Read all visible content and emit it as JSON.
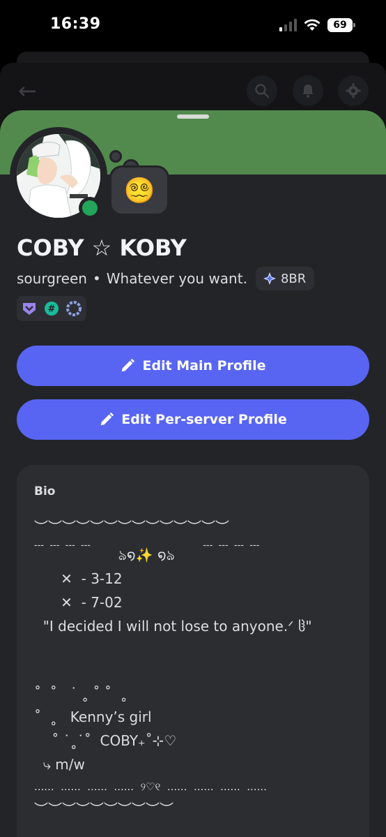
{
  "status_bar": {
    "time": "16:39",
    "battery": "69",
    "icons": [
      "signal-icon",
      "wifi-icon",
      "battery-icon"
    ]
  },
  "background_page": {
    "icons": [
      "back-arrow-icon",
      "search-icon",
      "bell-icon",
      "gear-icon"
    ]
  },
  "profile": {
    "banner_color": "#528a4d",
    "display_name": "COBY ☆ KOBY",
    "username": "sourgreen",
    "separator": "•",
    "pronouns": "Whatever you want.",
    "clan_tag": "8BR",
    "status_emoji": "😵‍💫",
    "status": "online",
    "badges": [
      "hypesquad-balance-icon",
      "hashtag-icon",
      "quest-badge-icon"
    ]
  },
  "buttons": {
    "edit_main": "Edit Main Profile",
    "edit_server": "Edit Per-server Profile",
    "accent": "#5865f2"
  },
  "bio": {
    "title": "Bio",
    "lines": [
      "︶︶︶︶︶︶︶︶︶︶︶︶︶︶",
      "---  ---  ---  ---                                       ---  ---  ---  ---",
      "                   ঌ໑✨ ໑ঌ",
      "      ✕  - 3-12",
      "      ✕  - 7-02",
      "  \"I decided I will not lose to anyone.ᐟ ჱ\"",
      "",
      "˚  ˚   ˙ ˳ ˚ ˚  ˳",
      "˚  ˳   Kenny’s girl",
      "    ˚ ˙˳˙˚  COBY₊˚⊹♡",
      "  ⤷ m/w",
      "......  ......  ......  ......  ୨♡୧  ......  ......  ......  ......",
      "︶︶︶︶︶︶︶︶︶︶"
    ]
  }
}
